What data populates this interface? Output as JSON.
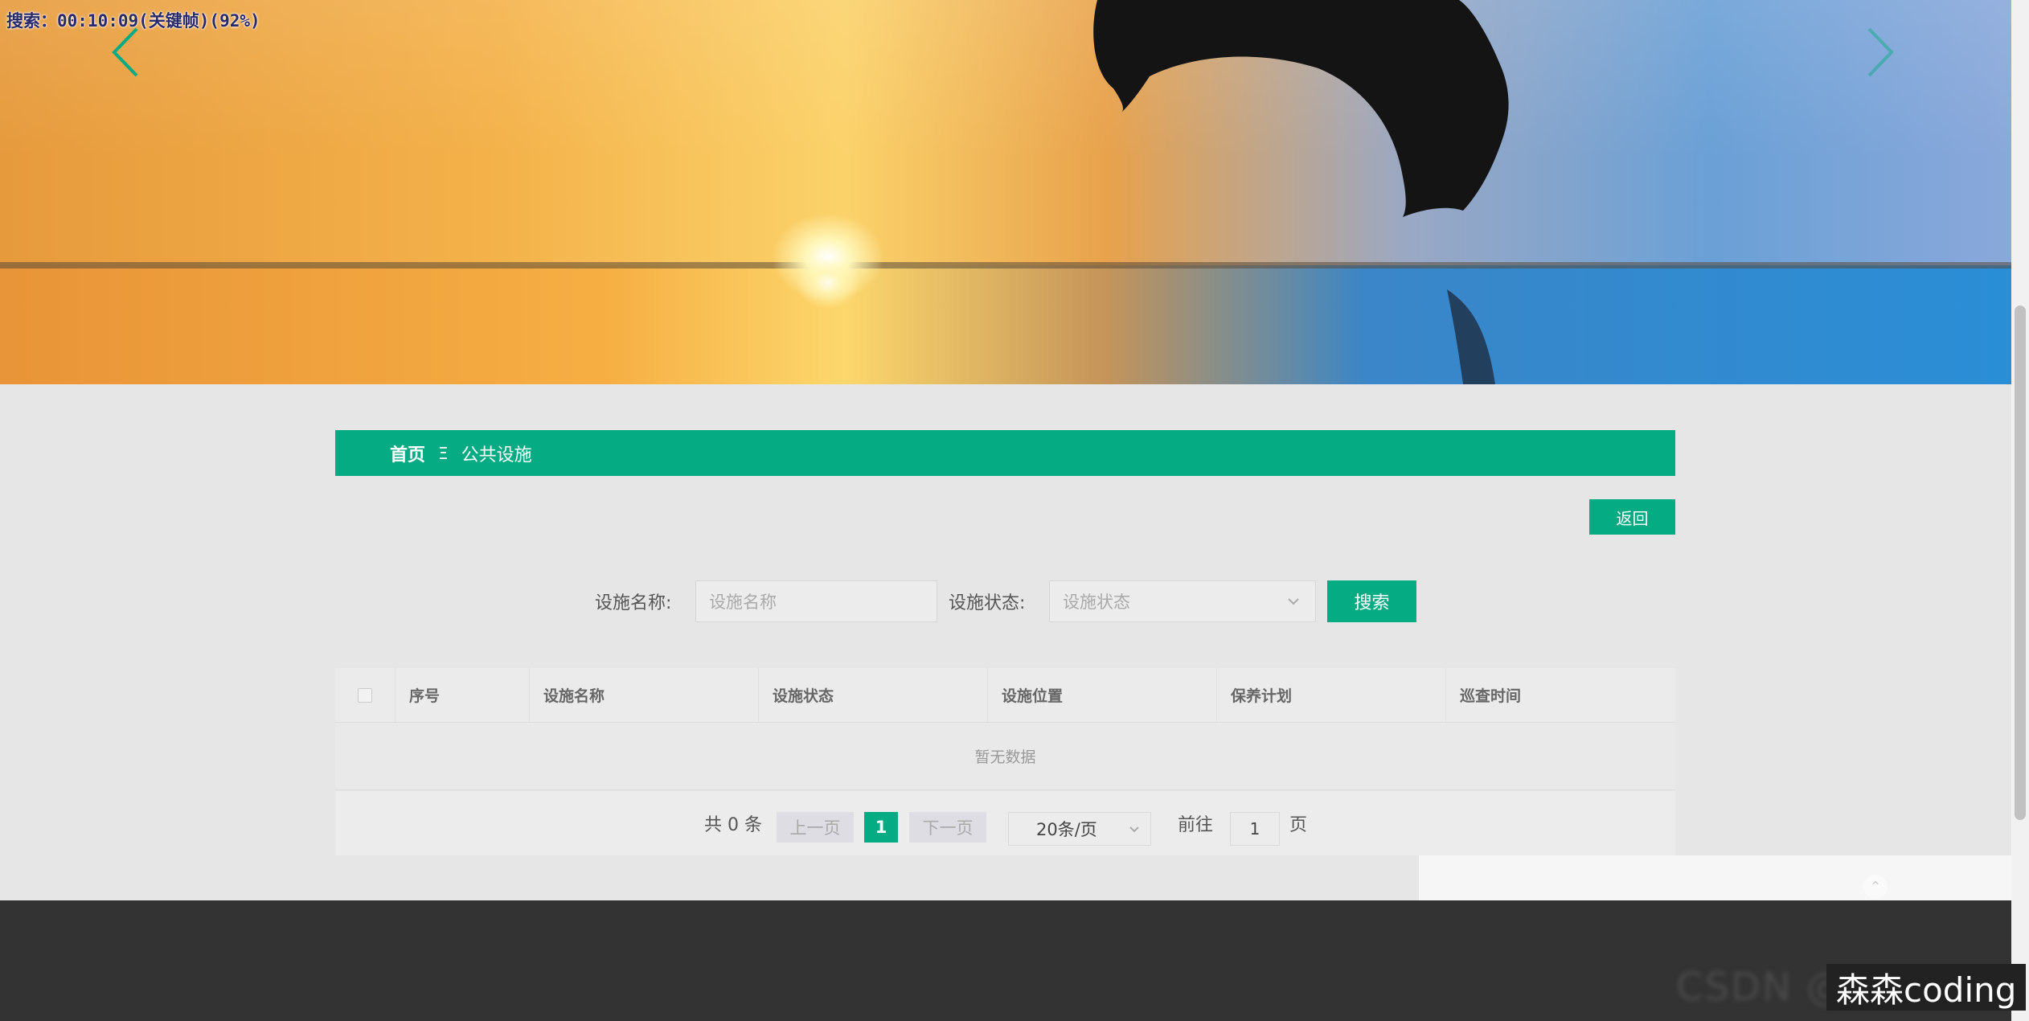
{
  "overlay": {
    "search_timer": "搜索：00:10:09(关键帧)(92%)"
  },
  "breadcrumb": {
    "home": "首页",
    "separator": "Ξ",
    "current": "公共设施"
  },
  "actions": {
    "back_label": "返回"
  },
  "search": {
    "name_label": "设施名称:",
    "name_placeholder": "设施名称",
    "status_label": "设施状态:",
    "status_placeholder": "设施状态",
    "search_label": "搜索"
  },
  "table": {
    "columns": [
      "序号",
      "设施名称",
      "设施状态",
      "设施位置",
      "保养计划",
      "巡查时间"
    ],
    "empty_text": "暂无数据"
  },
  "pagination": {
    "total_text": "共 0 条",
    "prev_label": "上一页",
    "current_page": "1",
    "next_label": "下一页",
    "page_size": "20条/页",
    "goto_label": "前往",
    "goto_value": "1",
    "page_suffix": "页"
  },
  "footer": {
    "blurred_text": "CSDN @",
    "watermark": "森森coding"
  },
  "colors": {
    "primary": "#04ab83",
    "footer": "#333333",
    "background": "#e6e6e6"
  },
  "icons": {
    "left_arrow": "chevron-left-icon",
    "right_arrow": "chevron-right-icon",
    "select": "chevron-down-icon",
    "back_to_top": "arrow-up-icon"
  }
}
